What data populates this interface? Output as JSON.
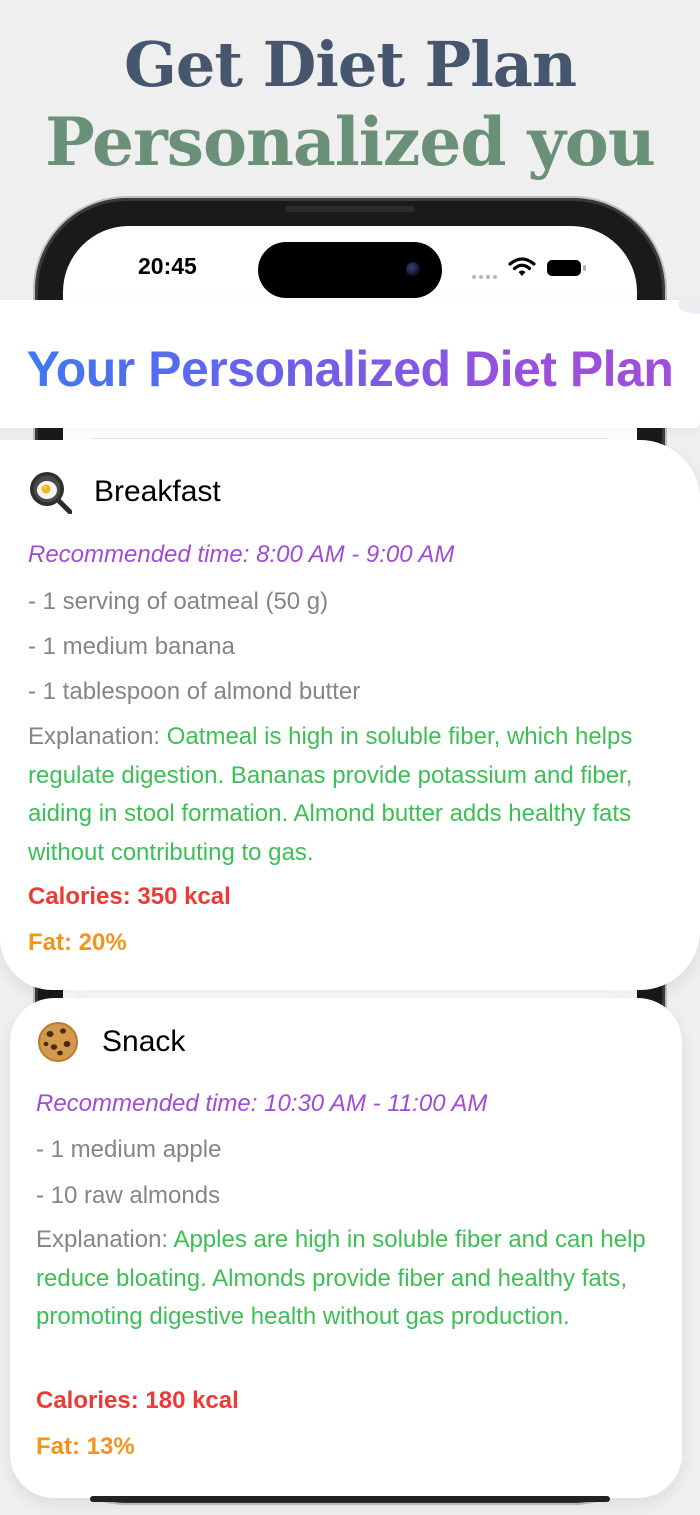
{
  "promo": {
    "line1": "Get Diet Plan",
    "line2": "Personalized you"
  },
  "status_bar": {
    "time": "20:45"
  },
  "page": {
    "title": "Your Personalized Diet Plan"
  },
  "meals": [
    {
      "name": "Breakfast",
      "icon": "frying-pan-egg-icon",
      "time": "Recommended time: 8:00 AM - 9:00 AM",
      "items": [
        "- 1 serving of oatmeal (50 g)",
        "- 1 medium banana",
        "- 1 tablespoon of almond butter"
      ],
      "explanation_label": "Explanation: ",
      "explanation": "Oatmeal is high in soluble fiber, which helps regulate digestion. Bananas provide potassium and fiber, aiding in stool formation. Almond butter adds healthy fats without contributing to gas.",
      "calories": "Calories: 350 kcal",
      "fat": "Fat: 20%"
    },
    {
      "name": "Snack",
      "icon": "cookie-icon",
      "time": "Recommended time: 10:30 AM - 11:00 AM",
      "items": [
        "- 1 medium apple",
        "- 10 raw almonds"
      ],
      "explanation_label": "Explanation: ",
      "explanation": "Apples are high in soluble fiber and can help reduce bloating. Almonds provide fiber and healthy fats, promoting digestive health without gas production.",
      "calories": "Calories: 180 kcal",
      "fat": "Fat: 13%"
    }
  ],
  "colors": {
    "promo_line1": "#46566e",
    "promo_line2": "#6b9078",
    "title_gradient_start": "#3a7bf2",
    "title_gradient_end": "#a051d8",
    "time_text": "#a04cd6",
    "item_text": "#858585",
    "explanation_text": "#3cbf54",
    "calories_text": "#ee3a36",
    "fat_text": "#f5931c"
  }
}
